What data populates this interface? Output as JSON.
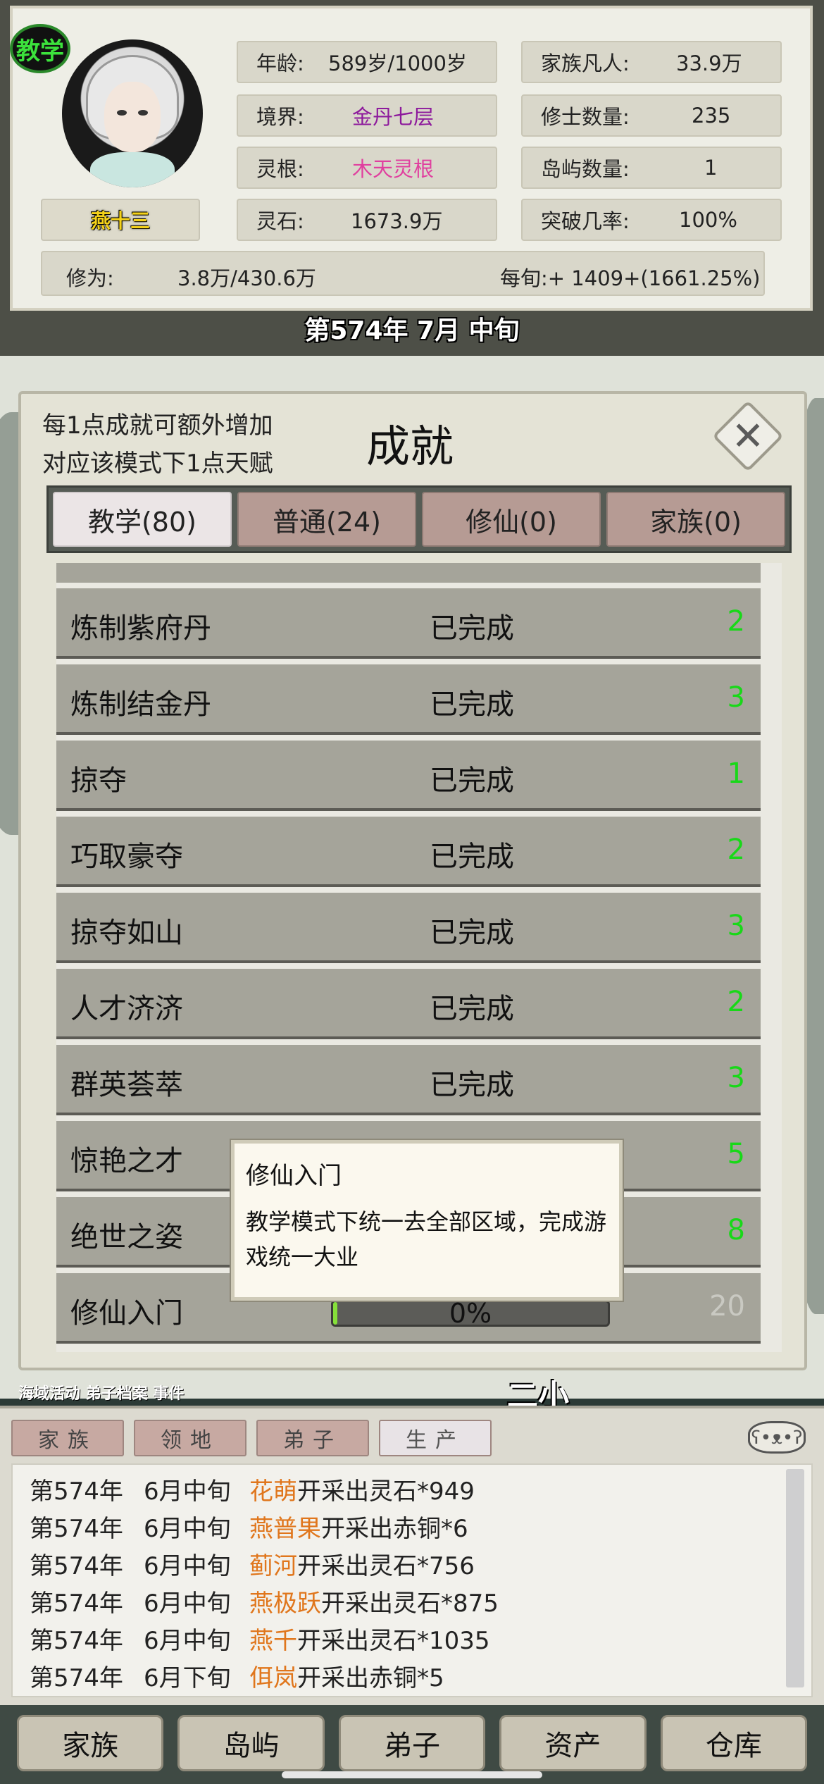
{
  "header": {
    "mode_badge": "教学",
    "character_name": "燕十三",
    "stats_left": [
      {
        "label": "年龄:",
        "value": "589岁/1000岁",
        "color": "#222222"
      },
      {
        "label": "境界:",
        "value": "金丹七层",
        "color": "#8d1a9c"
      },
      {
        "label": "灵根:",
        "value": "木天灵根",
        "color": "#e0409f"
      },
      {
        "label": "灵石:",
        "value": "1673.9万",
        "color": "#222222"
      }
    ],
    "stats_right": [
      {
        "label": "家族凡人:",
        "value": "33.9万"
      },
      {
        "label": "修士数量:",
        "value": "235"
      },
      {
        "label": "岛屿数量:",
        "value": "1"
      },
      {
        "label": "突破几率:",
        "value": "100%"
      }
    ],
    "cultivation_label": "修为:",
    "cultivation_value": "3.8万/430.6万",
    "per_period": "每旬:+ 1409+(1661.25%)",
    "date": "第574年 7月 中旬"
  },
  "map": {
    "bottom_left_text": "海域活动  弟子档案    事件",
    "banner_text": "二小"
  },
  "dialog": {
    "hint_line1": "每1点成就可额外增加",
    "hint_line2": "对应该模式下1点天赋",
    "title": "成就",
    "tabs": [
      "教学(80)",
      "普通(24)",
      "修仙(0)",
      "家族(0)"
    ],
    "active_tab": 0,
    "rows": [
      {
        "name": "炼制紫府丹",
        "status": "已完成",
        "points": "2"
      },
      {
        "name": "炼制结金丹",
        "status": "已完成",
        "points": "3"
      },
      {
        "name": "掠夺",
        "status": "已完成",
        "points": "1"
      },
      {
        "name": "巧取豪夺",
        "status": "已完成",
        "points": "2"
      },
      {
        "name": "掠夺如山",
        "status": "已完成",
        "points": "3"
      },
      {
        "name": "人才济济",
        "status": "已完成",
        "points": "2"
      },
      {
        "name": "群英荟萃",
        "status": "已完成",
        "points": "3"
      },
      {
        "name": "惊艳之才",
        "status": "",
        "points": "5"
      },
      {
        "name": "绝世之姿",
        "status": "",
        "points": "8"
      },
      {
        "name": "修仙入门",
        "status": "",
        "points": "20",
        "progress_text": "0%",
        "progress_fraction": 0.01
      }
    ],
    "tooltip": {
      "title": "修仙入门",
      "description": "教学模式下统一去全部区域，完成游戏统一大业"
    }
  },
  "log": {
    "tabs": [
      "家族",
      "领地",
      "弟子",
      "生产"
    ],
    "active_tab": 3,
    "entries": [
      {
        "year": "第574年",
        "period": "6月中旬",
        "who": "花萌",
        "text": "开采出灵石*949"
      },
      {
        "year": "第574年",
        "period": "6月中旬",
        "who": "燕普果",
        "text": "开采出赤铜*6"
      },
      {
        "year": "第574年",
        "period": "6月中旬",
        "who": "蓟河",
        "text": "开采出灵石*756"
      },
      {
        "year": "第574年",
        "period": "6月中旬",
        "who": "燕极跃",
        "text": "开采出灵石*875"
      },
      {
        "year": "第574年",
        "period": "6月中旬",
        "who": "燕千",
        "text": "开采出灵石*1035"
      },
      {
        "year": "第574年",
        "period": "6月下旬",
        "who": "佴岚",
        "text": "开采出赤铜*5"
      }
    ]
  },
  "bottom_nav": [
    "家族",
    "岛屿",
    "弟子",
    "资产",
    "仓库"
  ]
}
